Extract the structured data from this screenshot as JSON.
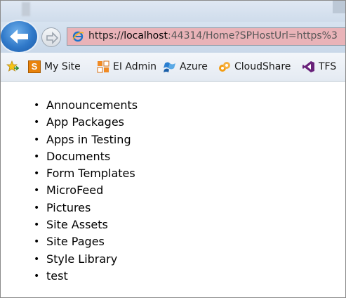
{
  "browser": {
    "title_blurred": "",
    "address": {
      "scheme": "https://",
      "host": "localhost",
      "rest": ":44314/Home?SPHostUrl=https%3"
    }
  },
  "favorites": [
    {
      "label": "My Site",
      "icon": "sharepoint-s-icon"
    },
    {
      "label": "EI Admin",
      "icon": "admin-grid-icon"
    },
    {
      "label": "Azure",
      "icon": "azure-flag-icon"
    },
    {
      "label": "CloudShare",
      "icon": "cloudshare-icon"
    },
    {
      "label": "TFS",
      "icon": "visual-studio-icon"
    }
  ],
  "lists": [
    "Announcements",
    "App Packages",
    "Apps in Testing",
    "Documents",
    "Form Templates",
    "MicroFeed",
    "Pictures",
    "Site Assets",
    "Site Pages",
    "Style Library",
    "test"
  ]
}
